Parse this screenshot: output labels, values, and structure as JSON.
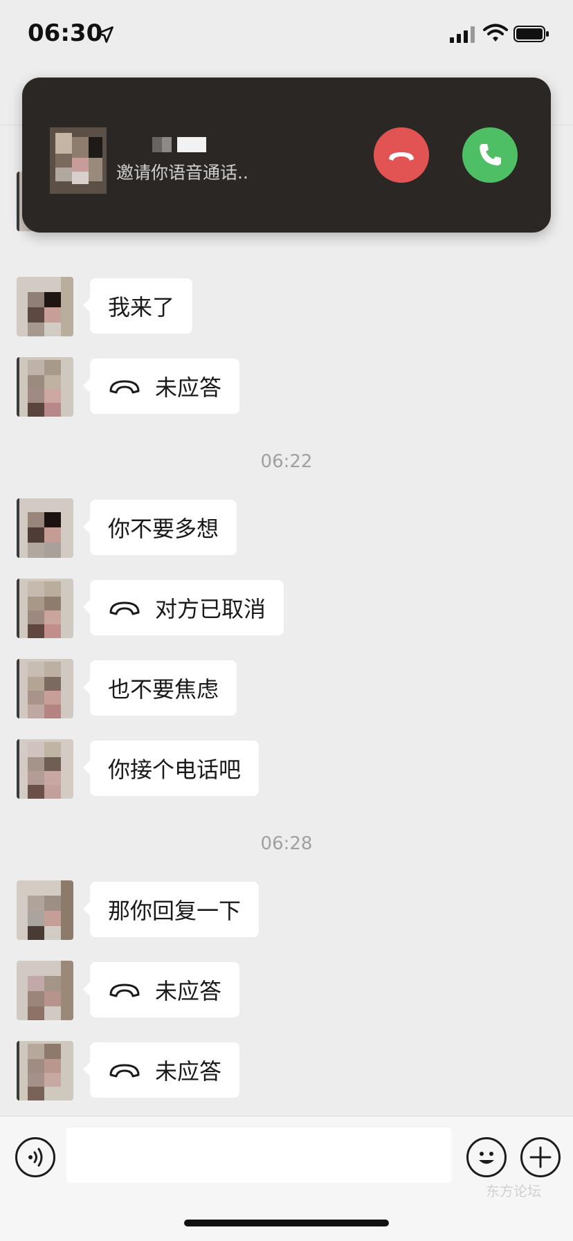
{
  "status_bar": {
    "time": "06:30"
  },
  "call_banner": {
    "subtitle": "邀请你语音通话.."
  },
  "messages": [
    {
      "text": "我来了"
    },
    {
      "text": "未应答",
      "call": true
    },
    {
      "text": "你不要多想"
    },
    {
      "text": "对方已取消",
      "call": true
    },
    {
      "text": "也不要焦虑"
    },
    {
      "text": "你接个电话吧"
    },
    {
      "text": "那你回复一下"
    },
    {
      "text": "未应答",
      "call": true
    },
    {
      "text": "未应答",
      "call": true
    }
  ],
  "timestamps": [
    "06:22",
    "06:28"
  ],
  "input": {
    "value": ""
  },
  "watermark": "东方论坛",
  "colors": {
    "decline": "#e25454",
    "accept": "#4fbf65",
    "background": "#ededed"
  }
}
